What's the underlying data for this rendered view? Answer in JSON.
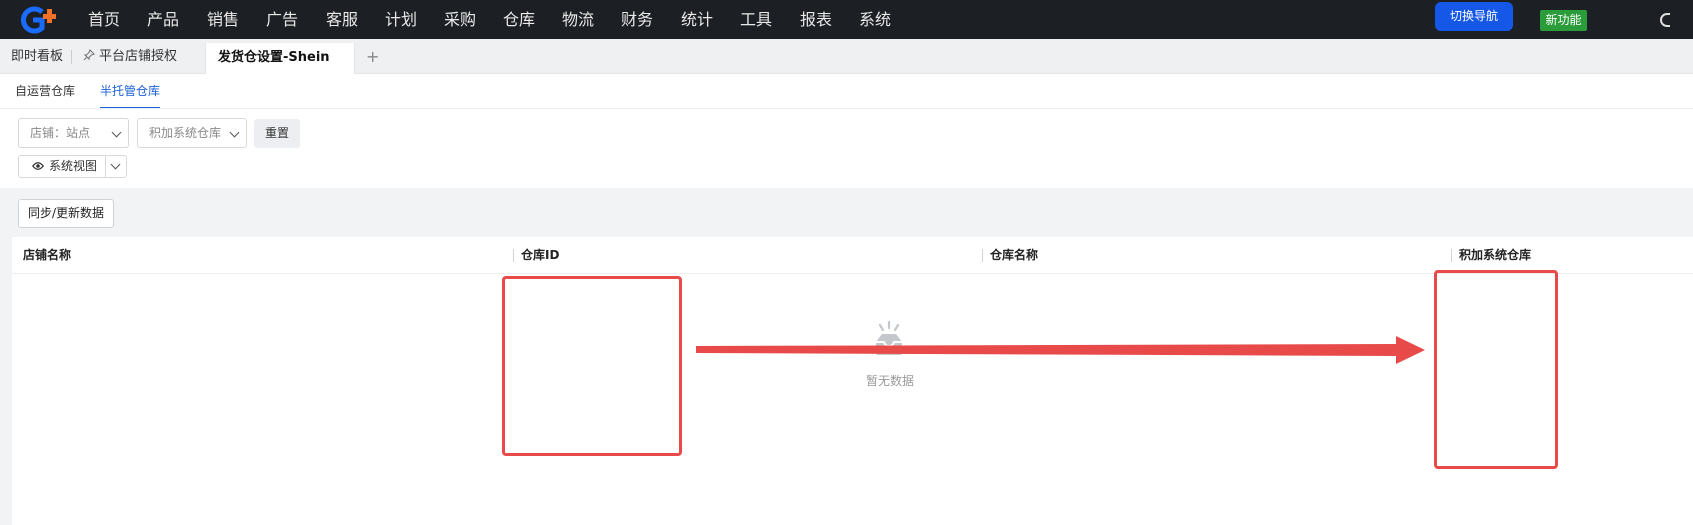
{
  "colors": {
    "topnav_bg": "#1c1f24",
    "accent_blue": "#1a5fd6",
    "switch_btn": "#1557e6",
    "new_badge": "#2a9d3a",
    "annotation_red": "#e84a4a"
  },
  "topnav": {
    "logo": "logo-icon",
    "items": [
      "首页",
      "产品",
      "销售",
      "广告",
      "客服",
      "计划",
      "采购",
      "仓库",
      "物流",
      "财务",
      "统计",
      "工具",
      "报表",
      "系统"
    ],
    "switch_nav_label": "切换导航",
    "new_feature_label": "新功能"
  },
  "tabs": {
    "items": [
      {
        "label": "即时看板"
      },
      {
        "label": "平台店铺授权",
        "icon": "pin-icon"
      },
      {
        "label": "发货仓设置-Shein",
        "active": true
      }
    ],
    "add_label": "+"
  },
  "subtabs": {
    "items": [
      "自运营仓库",
      "半托管仓库"
    ],
    "active_index": 1
  },
  "filters": {
    "store_select": {
      "placeholder": "店铺：站点"
    },
    "warehouse_select": {
      "placeholder": "积加系统仓库"
    },
    "reset_label": "重置",
    "view_label": "系统视图"
  },
  "actions": {
    "sync_label": "同步/更新数据"
  },
  "table": {
    "columns": [
      "店铺名称",
      "仓库ID",
      "仓库名称",
      "积加系统仓库"
    ],
    "rows": [],
    "empty_text": "暂无数据"
  }
}
